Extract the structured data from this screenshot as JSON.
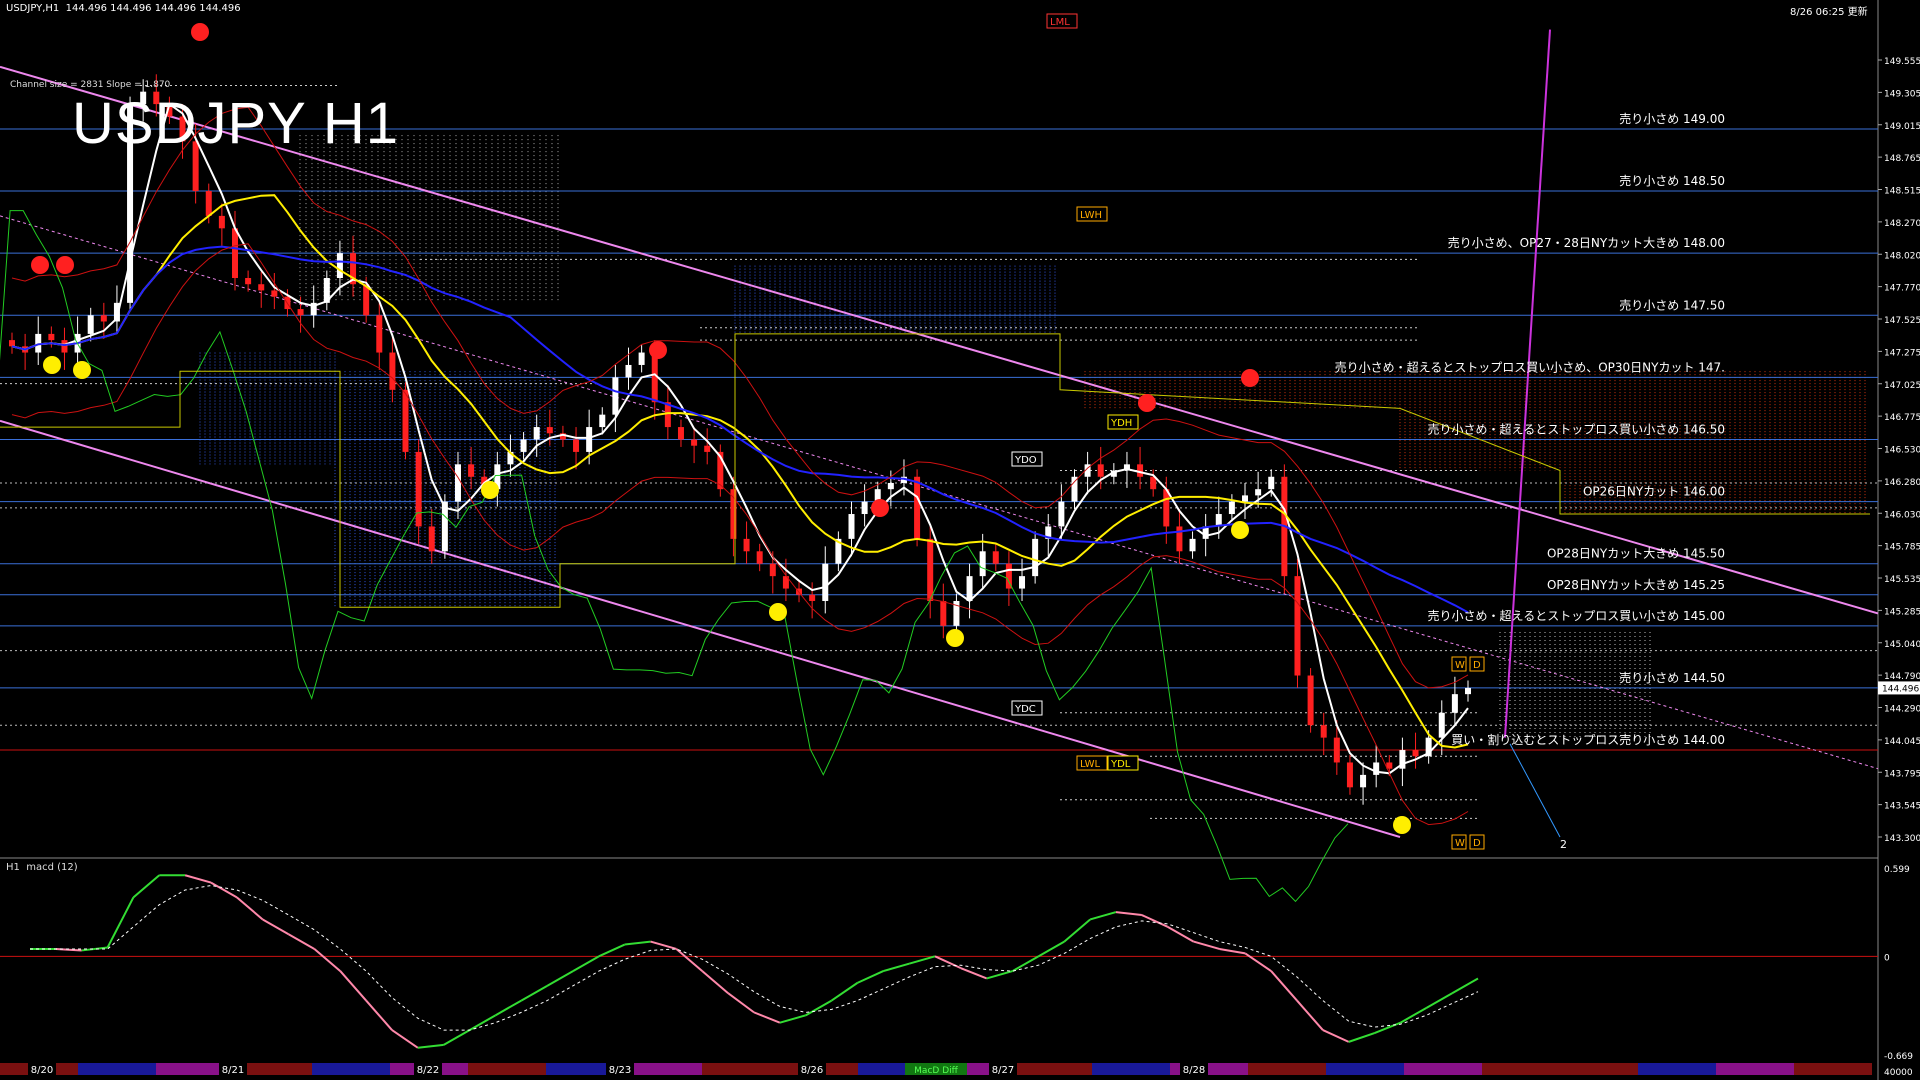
{
  "header": {
    "symbol_info": "USDJPY,H1  144.496 144.496 144.496 144.496",
    "timestamp": "8/26 06:25 更新"
  },
  "big_title": "USDJPY H1",
  "channel_info": "Channel size = 2831 Slope = 1.870",
  "price_axis": {
    "labels": [
      "149.555",
      "149.305",
      "149.015",
      "148.765",
      "148.515",
      "148.270",
      "148.020",
      "147.770",
      "147.525",
      "147.275",
      "147.025",
      "146.775",
      "146.530",
      "146.280",
      "146.030",
      "145.785",
      "145.535",
      "145.285",
      "145.040",
      "144.790",
      "144.290",
      "144.045",
      "143.795",
      "143.545",
      "143.300"
    ],
    "current_price": "144.496"
  },
  "macd_axis": {
    "top": "0.599",
    "zero": "0",
    "bottom": "-0.669",
    "footer": "40000"
  },
  "macd_label": "H1  macd (12)",
  "dates": [
    "8/20",
    "8/21",
    "8/22",
    "8/23",
    "8/26",
    "8/27",
    "8/28"
  ],
  "bottom_tag": "MacD Diff",
  "level_tags": {
    "lml": "LML",
    "lwh": "LWH",
    "ydh": "YDH",
    "ydo": "YDO",
    "ydc": "YDC",
    "lwl": "LWL",
    "ydl": "YDL",
    "w1": "W",
    "d1": "D",
    "w2": "W",
    "d2": "D",
    "num": "2"
  },
  "annotations": [
    {
      "price": 149.0,
      "text": "売り小さめ 149.00"
    },
    {
      "price": 148.5,
      "text": "売り小さめ 148.50"
    },
    {
      "price": 148.0,
      "text": "売り小さめ、OP27・28日NYカット大きめ 148.00"
    },
    {
      "price": 147.5,
      "text": "売り小さめ 147.50"
    },
    {
      "price": 147.0,
      "text": "売り小さめ・超えるとストップロス買い小さめ、OP30日NYカット 147."
    },
    {
      "price": 146.5,
      "text": "売り小さめ・超えるとストップロス買い小さめ 146.50"
    },
    {
      "price": 146.0,
      "text": "OP26日NYカット 146.00"
    },
    {
      "price": 145.5,
      "text": "OP28日NYカット大きめ 145.50"
    },
    {
      "price": 145.25,
      "text": "OP28日NYカット大きめ 145.25"
    },
    {
      "price": 145.0,
      "text": "売り小さめ・超えるとストップロス買い小さめ 145.00"
    },
    {
      "price": 144.5,
      "text": "売り小さめ 144.50"
    },
    {
      "price": 144.0,
      "text": "買い・割り込むとストップロス売り小さめ 144.00"
    }
  ],
  "colors": {
    "background": "#000000",
    "bull": "#ffffff",
    "bear": "#ff2020",
    "ma_fast": "#ffffff",
    "ma_mid": "#ffee00",
    "ma_slow": "#2222ff",
    "channel": "#ee88ee",
    "hline": "#3a6fd8",
    "bollinger": "#cc1111",
    "chikou": "#22cc22",
    "kumo_up": "#3355dd",
    "kumo_down": "#cc3311",
    "macd_up": "#33dd33",
    "macd_down": "#ff88aa"
  },
  "chart_data": {
    "type": "candlestick",
    "x_labels": [
      "8/20",
      "8/21",
      "8/22",
      "8/23",
      "8/26",
      "8/27",
      "8/28"
    ],
    "ylim": [
      143.3,
      149.555
    ],
    "close": [
      147.25,
      147.2,
      147.35,
      147.3,
      147.2,
      147.35,
      147.5,
      147.45,
      147.6,
      149.2,
      149.3,
      149.2,
      149.1,
      148.9,
      148.5,
      148.3,
      148.2,
      147.8,
      147.75,
      147.7,
      147.65,
      147.55,
      147.5,
      147.6,
      147.8,
      148.0,
      147.75,
      147.5,
      147.2,
      146.9,
      146.4,
      145.8,
      145.6,
      146.0,
      146.3,
      146.2,
      146.1,
      146.3,
      146.4,
      146.5,
      146.6,
      146.55,
      146.5,
      146.4,
      146.6,
      146.7,
      147.0,
      147.1,
      147.2,
      146.8,
      146.6,
      146.5,
      146.45,
      146.4,
      146.1,
      145.7,
      145.6,
      145.5,
      145.4,
      145.3,
      145.25,
      145.2,
      145.5,
      145.7,
      145.9,
      146.0,
      146.1,
      146.15,
      146.2,
      145.7,
      145.2,
      145.0,
      145.2,
      145.4,
      145.6,
      145.5,
      145.3,
      145.4,
      145.7,
      145.8,
      146.0,
      146.2,
      146.3,
      146.2,
      146.25,
      146.3,
      146.2,
      146.1,
      145.8,
      145.6,
      145.7,
      145.8,
      145.9,
      146.0,
      146.05,
      146.1,
      146.2,
      145.4,
      144.6,
      144.2,
      144.1,
      143.9,
      143.7,
      143.8,
      143.9,
      143.85,
      144.0,
      143.95,
      144.1,
      144.3,
      144.45,
      144.5
    ],
    "macd": [
      0.05,
      0.05,
      0.04,
      0.06,
      0.4,
      0.55,
      0.55,
      0.5,
      0.4,
      0.25,
      0.15,
      0.05,
      -0.1,
      -0.3,
      -0.5,
      -0.62,
      -0.6,
      -0.5,
      -0.4,
      -0.3,
      -0.2,
      -0.1,
      0.0,
      0.08,
      0.1,
      0.05,
      -0.1,
      -0.25,
      -0.38,
      -0.45,
      -0.4,
      -0.3,
      -0.18,
      -0.1,
      -0.05,
      0.0,
      -0.08,
      -0.15,
      -0.1,
      0.0,
      0.1,
      0.25,
      0.3,
      0.28,
      0.2,
      0.1,
      0.05,
      0.02,
      -0.1,
      -0.3,
      -0.5,
      -0.58,
      -0.52,
      -0.45,
      -0.35,
      -0.25,
      -0.15
    ],
    "signal": [
      0.05,
      0.05,
      0.05,
      0.05,
      0.2,
      0.35,
      0.45,
      0.48,
      0.45,
      0.38,
      0.28,
      0.18,
      0.05,
      -0.1,
      -0.28,
      -0.42,
      -0.5,
      -0.5,
      -0.45,
      -0.38,
      -0.3,
      -0.2,
      -0.1,
      -0.02,
      0.04,
      0.05,
      -0.02,
      -0.12,
      -0.24,
      -0.34,
      -0.38,
      -0.36,
      -0.3,
      -0.22,
      -0.14,
      -0.07,
      -0.06,
      -0.09,
      -0.1,
      -0.06,
      0.02,
      0.12,
      0.2,
      0.24,
      0.22,
      0.16,
      0.1,
      0.06,
      0.0,
      -0.14,
      -0.3,
      -0.44,
      -0.48,
      -0.46,
      -0.4,
      -0.32,
      -0.24
    ]
  }
}
